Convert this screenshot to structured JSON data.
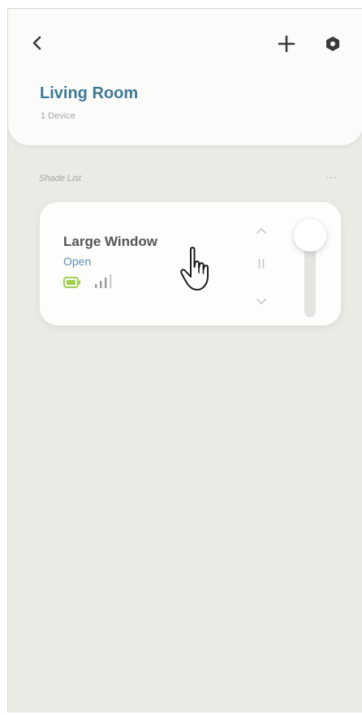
{
  "header": {
    "back_icon": "chevron-left-icon",
    "add_icon": "plus-icon",
    "settings_icon": "hexagon-settings-icon",
    "room_title": "Living Room",
    "device_count": "1 Device"
  },
  "shade_list": {
    "title": "Shade List",
    "more_label": "···"
  },
  "device": {
    "name": "Large Window",
    "status": "Open",
    "battery_icon": "battery-full-icon",
    "signal_icon": "signal-bars-icon",
    "position_fraction": 1.0
  },
  "controls": {
    "up_icon": "chevron-up-icon",
    "pause_icon": "pause-icon",
    "down_icon": "chevron-down-icon"
  },
  "colors": {
    "title": "#3d7a94",
    "status": "#5d93b4",
    "battery": "#9fd34f",
    "background": "#ebebe6"
  },
  "pointer_icon": "hand-pointer-icon"
}
